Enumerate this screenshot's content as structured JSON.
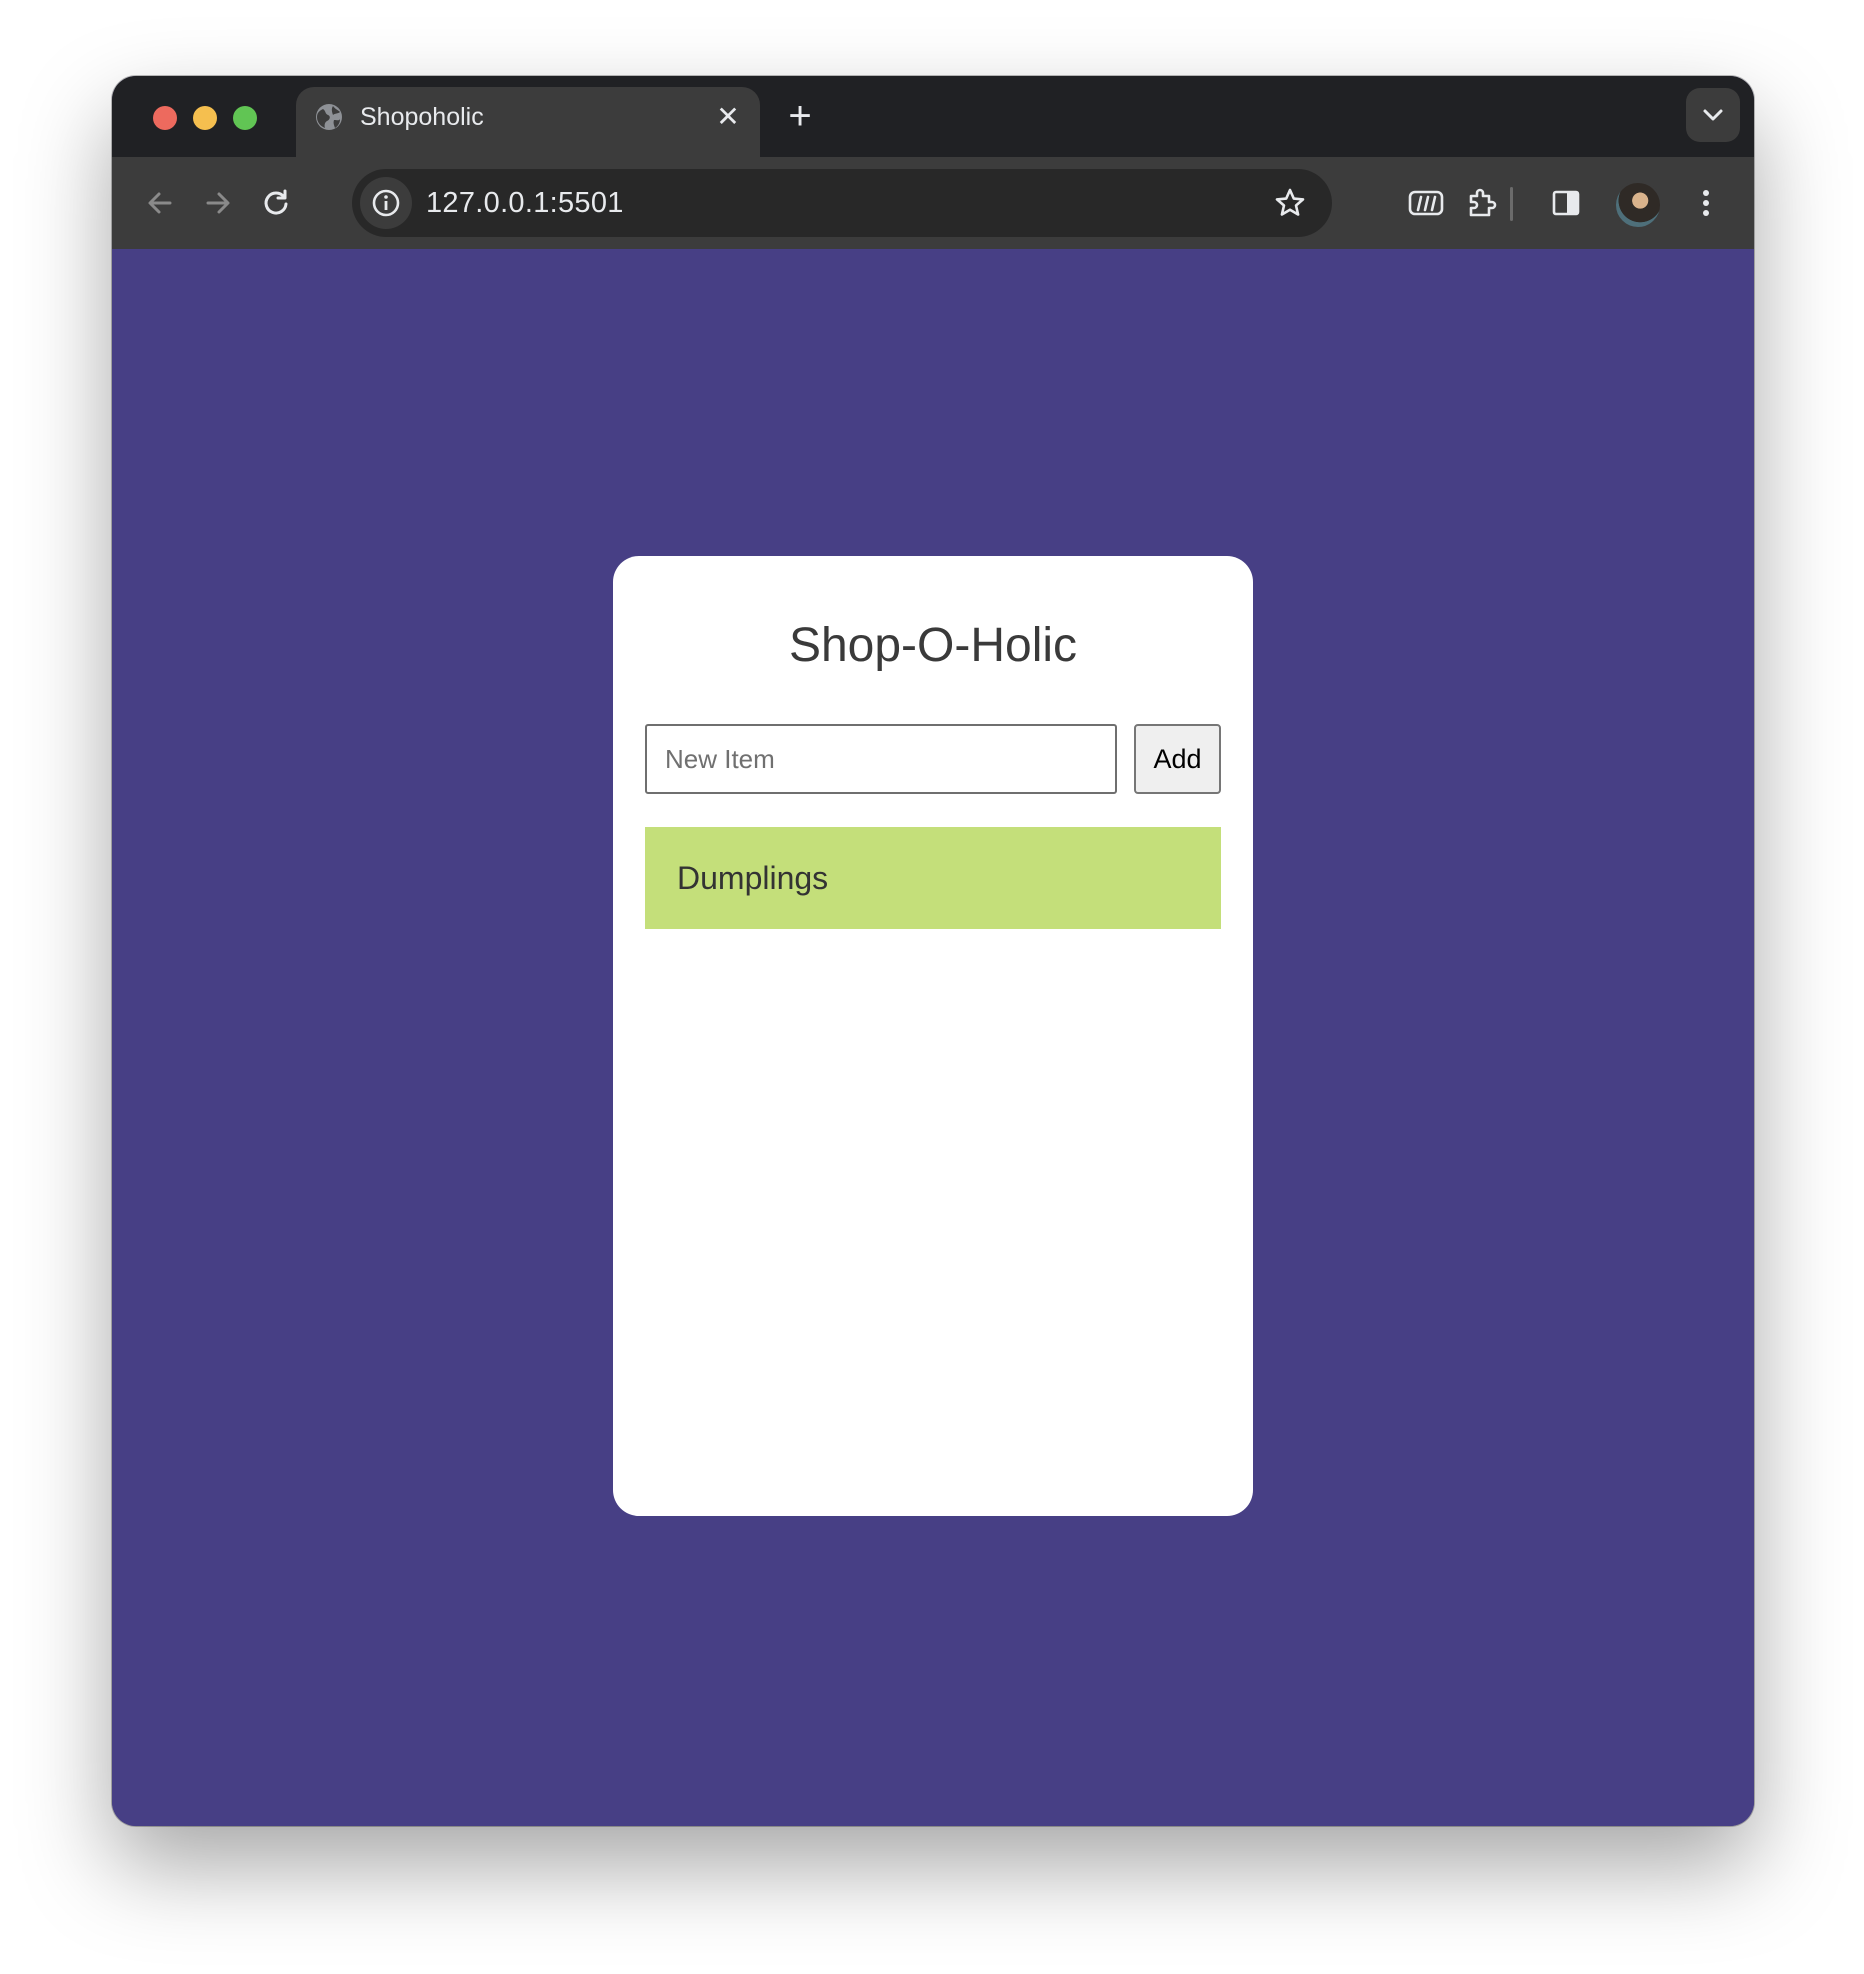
{
  "browser": {
    "tab": {
      "title": "Shopoholic",
      "close_glyph": "✕",
      "icon": "globe-icon"
    },
    "new_tab_glyph": "+",
    "address": {
      "url": "127.0.0.1:5501"
    },
    "icons": {
      "back": "arrow-left-icon",
      "forward": "arrow-right-icon",
      "reload": "reload-icon",
      "site_info": "info-icon",
      "bookmark": "star-icon",
      "extension_m": "miro-extension-icon",
      "extensions": "puzzle-icon",
      "side_panel": "side-panel-icon",
      "profile": "avatar",
      "menu": "kebab-menu-icon",
      "tab_search": "chevron-down-icon"
    }
  },
  "app": {
    "title": "Shop-O-Holic",
    "input": {
      "placeholder": "New Item",
      "value": ""
    },
    "add_label": "Add",
    "items": [
      {
        "label": "Dumplings"
      }
    ],
    "colors": {
      "background": "#473f85",
      "card": "#ffffff",
      "item": "#c4df7a"
    }
  }
}
